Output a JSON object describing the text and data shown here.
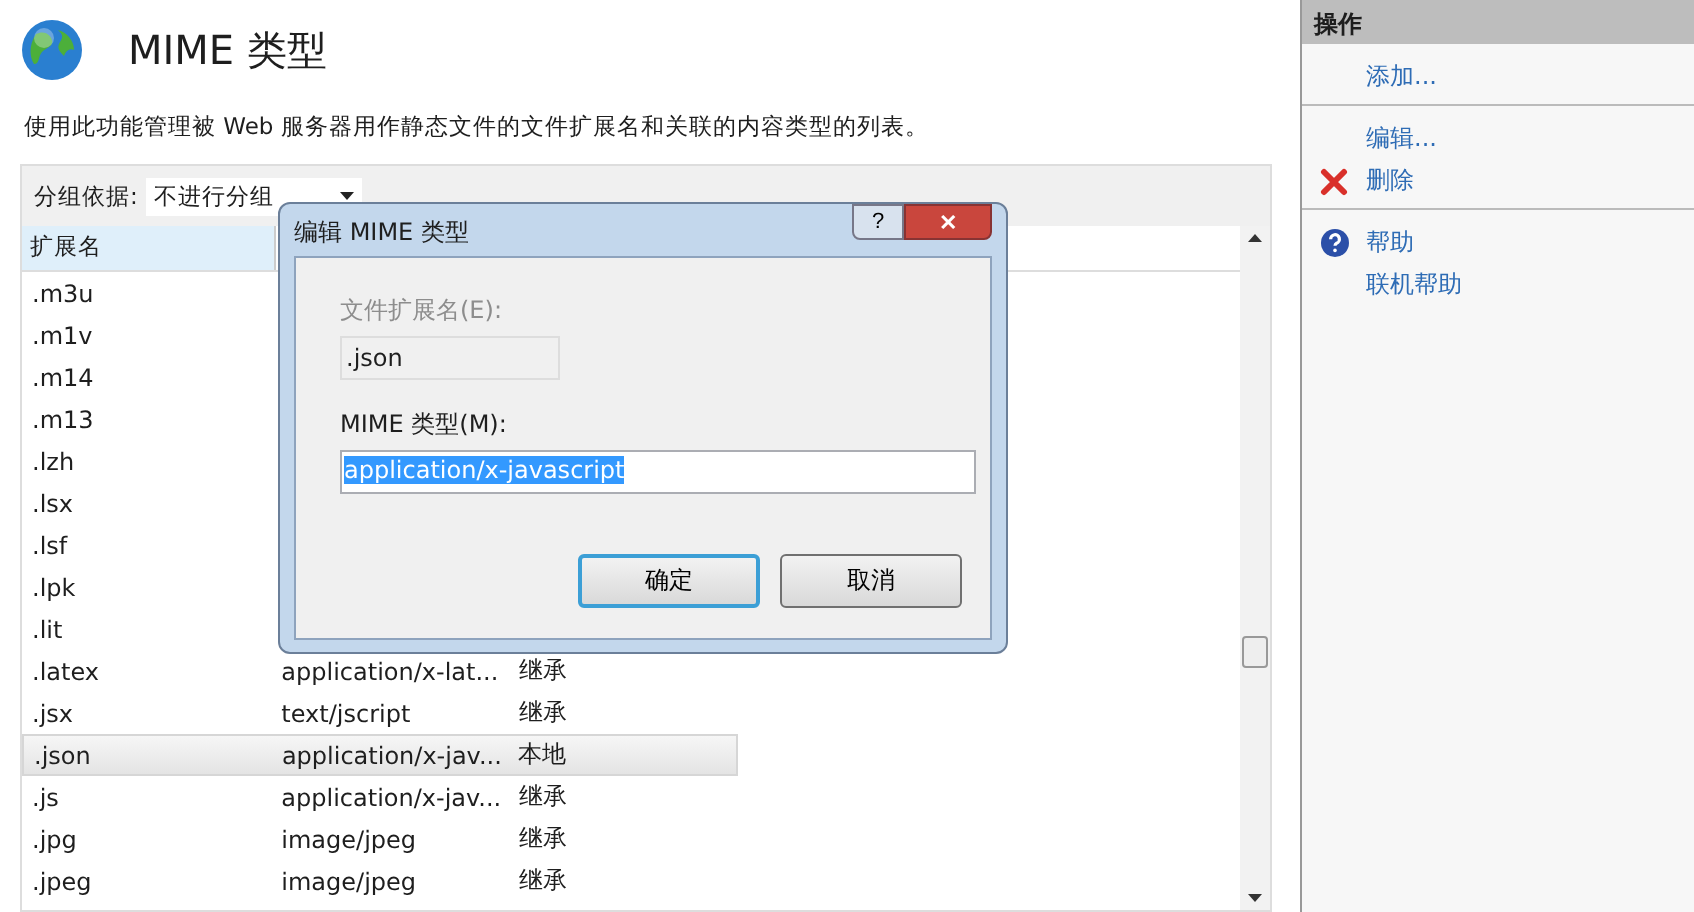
{
  "header": {
    "title": "MIME 类型",
    "description": "使用此功能管理被 Web 服务器用作静态文件的文件扩展名和关联的内容类型的列表。"
  },
  "toolbar": {
    "label": "分组依据:",
    "value": "不进行分组"
  },
  "table": {
    "columns": [
      "扩展名"
    ],
    "rows": [
      {
        "ext": ".m3u",
        "selected": false
      },
      {
        "ext": ".m1v",
        "selected": false
      },
      {
        "ext": ".m14",
        "selected": false
      },
      {
        "ext": ".m13",
        "selected": false
      },
      {
        "ext": ".lzh",
        "selected": false
      },
      {
        "ext": ".lsx",
        "selected": false
      },
      {
        "ext": ".lsf",
        "selected": false
      },
      {
        "ext": ".lpk",
        "selected": false
      },
      {
        "ext": ".lit",
        "selected": false
      },
      {
        "ext": ".latex",
        "mime": "application/x-lat...",
        "type": "继承",
        "selected": false
      },
      {
        "ext": ".jsx",
        "mime": "text/jscript",
        "type": "继承",
        "selected": false
      },
      {
        "ext": ".json",
        "mime": "application/x-jav...",
        "type": "本地",
        "selected": true
      },
      {
        "ext": ".js",
        "mime": "application/x-jav...",
        "type": "继承",
        "selected": false
      },
      {
        "ext": ".jpg",
        "mime": "image/jpeg",
        "type": "继承",
        "selected": false
      },
      {
        "ext": ".jpeg",
        "mime": "image/jpeg",
        "type": "继承",
        "selected": false
      }
    ]
  },
  "dialog": {
    "title": "编辑 MIME 类型",
    "help_button": "?",
    "close_button": "✕",
    "ext_label": "文件扩展名(E):",
    "ext_value": ".json",
    "mime_label": "MIME 类型(M):",
    "mime_value": "application/x-javascript",
    "buttons": [
      {
        "label": "确定",
        "default": true
      },
      {
        "label": "取消",
        "default": false
      }
    ]
  },
  "actions": {
    "title": "操作",
    "groups": [
      [
        {
          "label": "添加...",
          "kind": "plain"
        }
      ],
      [
        {
          "label": "编辑...",
          "kind": "plain"
        },
        {
          "label": "删除",
          "kind": "delete"
        }
      ],
      [
        {
          "label": "帮助",
          "kind": "help"
        },
        {
          "label": "联机帮助",
          "kind": "plain"
        }
      ]
    ]
  }
}
